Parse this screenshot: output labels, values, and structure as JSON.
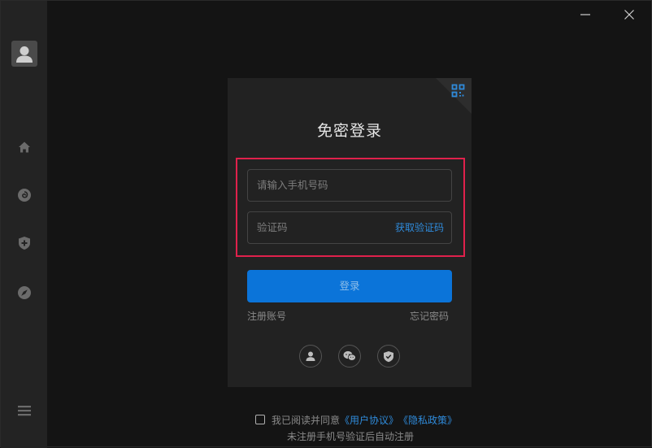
{
  "sidebar": {
    "avatar_icon": "user-avatar-icon",
    "items": [
      {
        "icon": "home-icon"
      },
      {
        "icon": "music-disc-icon"
      },
      {
        "icon": "shield-plus-icon"
      },
      {
        "icon": "compass-icon"
      }
    ],
    "menu_icon": "hamburger-menu-icon"
  },
  "window_controls": {
    "minimize_icon": "minimize-icon",
    "close_icon": "close-icon"
  },
  "login": {
    "title": "免密登录",
    "phone_placeholder": "请输入手机号码",
    "code_placeholder": "验证码",
    "get_code_label": "获取验证码",
    "login_label": "登录",
    "register_label": "注册账号",
    "forgot_label": "忘记密码",
    "social": [
      {
        "icon": "user-icon"
      },
      {
        "icon": "wechat-icon"
      },
      {
        "icon": "shield-check-icon"
      }
    ],
    "qr_icon": "qr-code-icon"
  },
  "agreement": {
    "prefix": "我已阅读并同意",
    "user_agreement": "《用户协议》",
    "privacy_policy": "《隐私政策》",
    "hint": "未注册手机号验证后自动注册"
  },
  "colors": {
    "accent": "#0b74d9",
    "link": "#2f8bdb",
    "highlight": "#e0214c",
    "background": "#141414",
    "sidebar": "#232323",
    "card": "#222222"
  }
}
